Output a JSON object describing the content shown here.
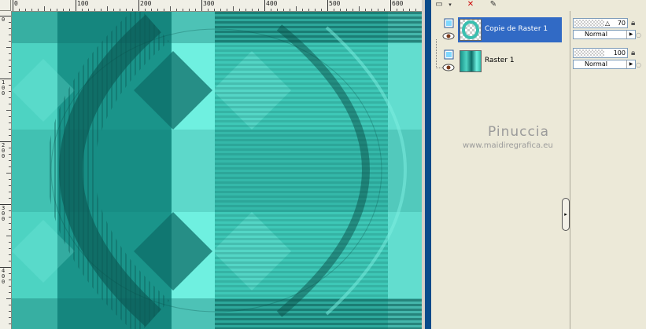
{
  "ruler": {
    "h_labels": [
      "0",
      "100",
      "200",
      "300",
      "400",
      "500",
      "600"
    ],
    "v_labels": [
      "0",
      "1\n0\n0",
      "2\n0\n0",
      "3\n0\n0",
      "4\n0\n0"
    ]
  },
  "canvas": {
    "colors": {
      "dark": "#0d6e68",
      "mid": "#27b3a5",
      "light": "#66e8d8",
      "accent": "#4fd9c6"
    }
  },
  "layers": [
    {
      "name": "Copie de Raster 1",
      "selected": true,
      "opacity": "70",
      "blend": "Normal"
    },
    {
      "name": "Raster 1",
      "selected": false,
      "opacity": "100",
      "blend": "Normal"
    }
  ],
  "watermark": {
    "title": "Pinuccia",
    "url": "www.maidiregrafica.eu"
  },
  "icons": [
    "new-layer-icon",
    "delete-layer-icon",
    "paint-icon",
    "eye-icon",
    "lock-icon",
    "raster-layer-icon"
  ]
}
